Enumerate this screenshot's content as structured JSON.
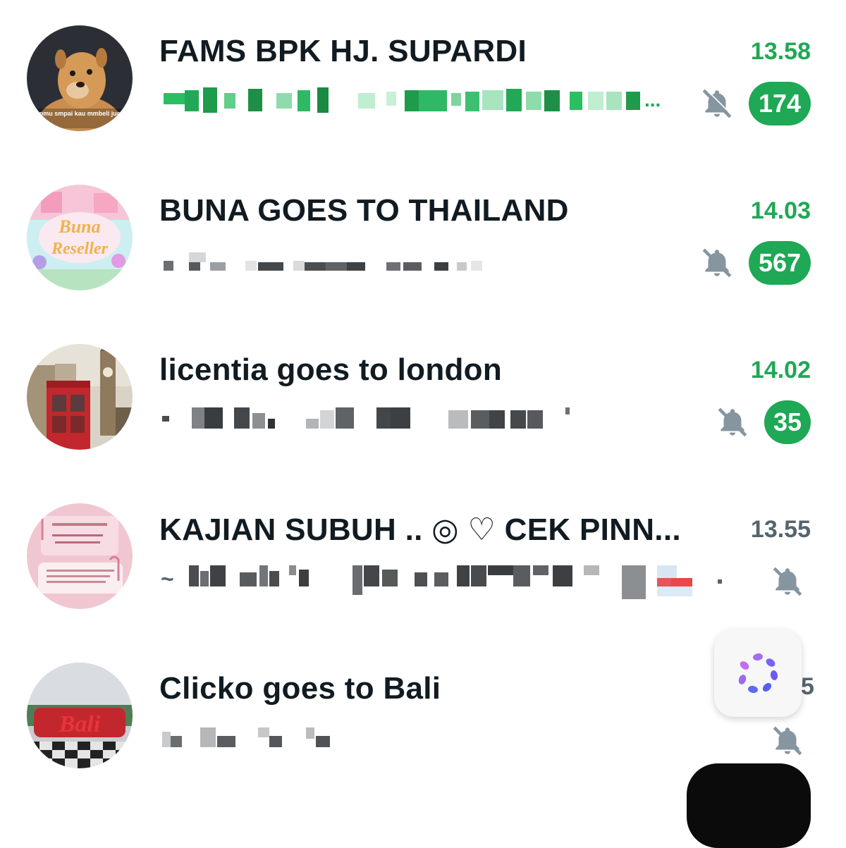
{
  "chats": [
    {
      "title": "FAMS BPK HJ. SUPARDI",
      "time": "13.58",
      "unread_count": "174",
      "muted": true,
      "avatar_icon": "dog-meme-avatar",
      "avatar_caption": "mnatapmu smpai kau mmbeli jualan ku"
    },
    {
      "title": "BUNA GOES TO THAILAND",
      "time": "14.03",
      "unread_count": "567",
      "muted": true,
      "avatar_icon": "buna-reseller-logo",
      "avatar_logo_line1": "Buna",
      "avatar_logo_line2": "Reseller"
    },
    {
      "title": "licentia goes to london",
      "time": "14.02",
      "unread_count": "35",
      "muted": true,
      "avatar_icon": "london-phone-booth-photo"
    },
    {
      "title": "KAJIAN SUBUH .. ◎ ♡ CEK PINN...",
      "time": "13.55",
      "unread_count": "",
      "muted": true,
      "avatar_icon": "pink-note-avatar",
      "preview_prefix": "~"
    },
    {
      "title": "Clicko goes to Bali",
      "time": "5",
      "unread_count": "",
      "muted": true,
      "avatar_icon": "bali-sign-photo"
    }
  ],
  "preview_ellipsis": "...",
  "preview_trailing": ".",
  "floating_buttons": {
    "meta_ai": "meta-ai-icon",
    "new_chat": "new-chat-button"
  },
  "colors": {
    "accent_green": "#1fa855",
    "title_text": "#111b21",
    "muted_gray": "#54656f",
    "background": "#ffffff"
  }
}
